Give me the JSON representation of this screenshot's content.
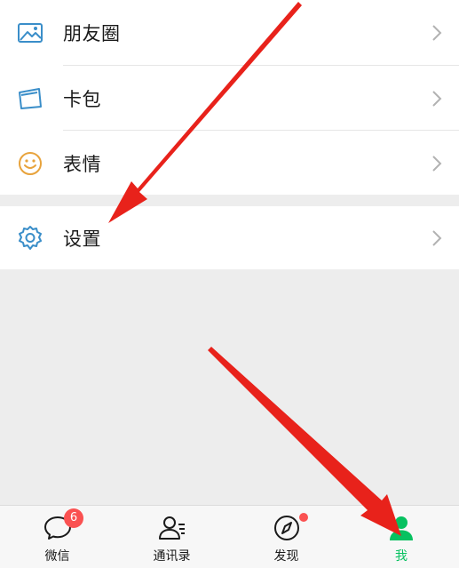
{
  "menu": {
    "items": [
      {
        "label": "朋友圈",
        "icon": "moments-icon"
      },
      {
        "label": "卡包",
        "icon": "card-wallet-icon"
      },
      {
        "label": "表情",
        "icon": "emoji-icon"
      },
      {
        "label": "设置",
        "icon": "settings-gear-icon"
      }
    ]
  },
  "tabbar": {
    "tabs": [
      {
        "label": "微信",
        "icon": "chat-bubble-icon",
        "badge": "6"
      },
      {
        "label": "通讯录",
        "icon": "contacts-icon"
      },
      {
        "label": "发现",
        "icon": "compass-icon",
        "dot": true
      },
      {
        "label": "我",
        "icon": "person-icon",
        "active": true
      }
    ]
  },
  "colors": {
    "accent": "#07c160",
    "badge": "#fa5151",
    "annotation_arrow": "#e8221b",
    "icon_blue": "#3a8ec9",
    "icon_orange": "#e8a33c"
  }
}
